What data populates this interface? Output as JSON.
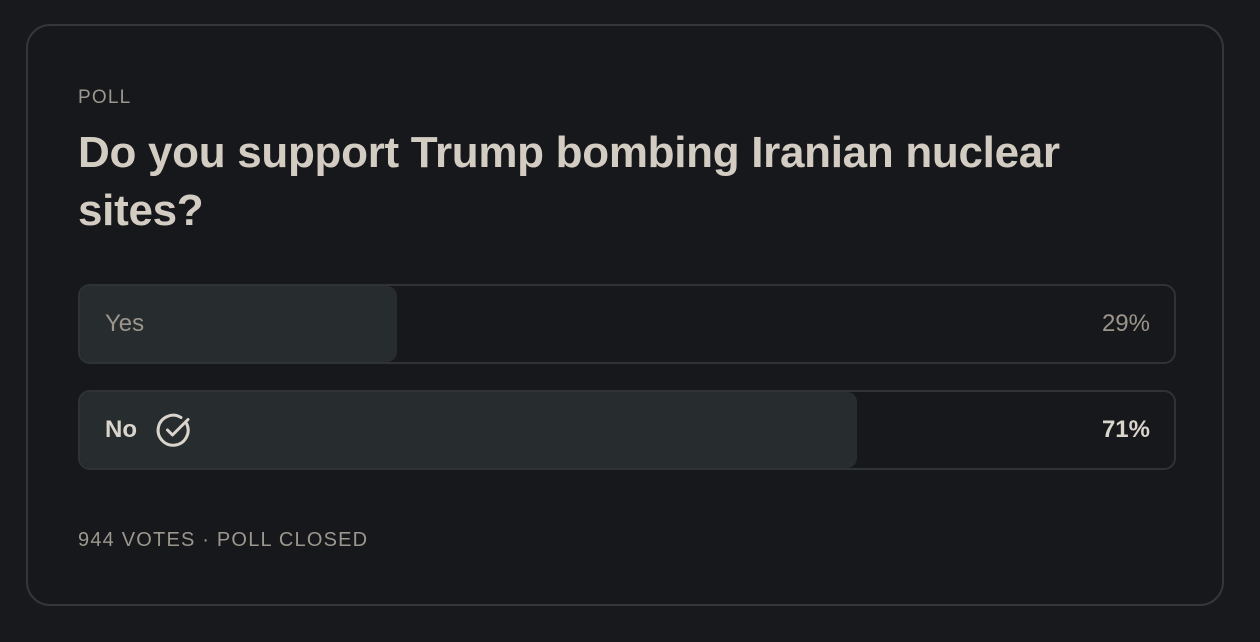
{
  "poll": {
    "label": "POLL",
    "question": "Do you support Trump bombing Iranian nuclear sites?",
    "options": [
      {
        "label": "Yes",
        "percent_text": "29%",
        "share": 0.29,
        "selected": false
      },
      {
        "label": "No",
        "percent_text": "71%",
        "share": 0.71,
        "selected": true,
        "icon": "check-circle-icon"
      }
    ],
    "footer": "944 VOTES · POLL CLOSED"
  },
  "colors": {
    "background": "#18191c",
    "card_border": "#34363b",
    "bar_fill": "#272c2f",
    "text_primary": "#d3ccc2",
    "text_muted": "#9c978e"
  }
}
